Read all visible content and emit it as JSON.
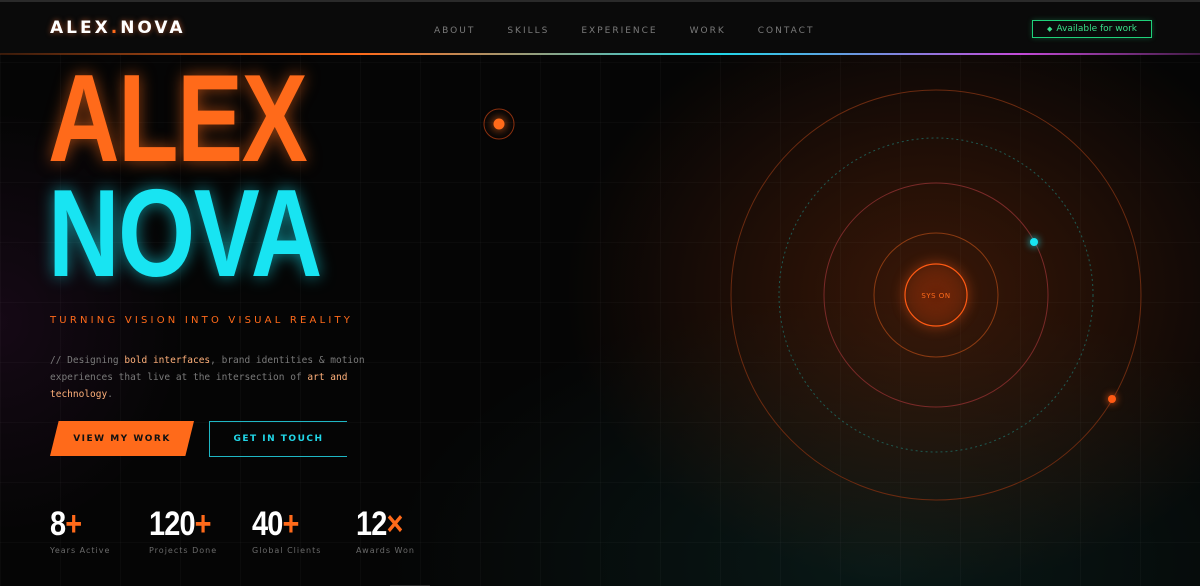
{
  "nav": {
    "logo_main": "ALEX",
    "logo_dot": ".",
    "logo_rest": "NOVA",
    "links": [
      "ABOUT",
      "SKILLS",
      "EXPERIENCE",
      "WORK",
      "CONTACT"
    ],
    "status_label": "Available for work"
  },
  "hero": {
    "name_first": "ALEX",
    "name_second": "NOVA",
    "tagline": "TURNING VISION INTO VISUAL REALITY",
    "desc_prefix": "// Designing ",
    "desc_hl1": "bold interfaces",
    "desc_mid": ", brand identities & motion experiences that live at the intersection of ",
    "desc_hl2": "art and technology",
    "desc_end": ".",
    "primary_cta": "VIEW MY WORK",
    "secondary_cta": "GET IN TOUCH"
  },
  "stats": [
    {
      "value": "8",
      "suffix": "+",
      "label": "Years Active"
    },
    {
      "value": "120",
      "suffix": "+",
      "label": "Projects Done"
    },
    {
      "value": "40",
      "suffix": "+",
      "label": "Global Clients"
    },
    {
      "value": "12",
      "suffix": "×",
      "label": "Awards Won"
    }
  ],
  "orbit": {
    "core_label": "SYS ON"
  },
  "colors": {
    "accent_orange": "#ff6a1a",
    "accent_cyan": "#18e4f2",
    "status_green": "#39e08a"
  }
}
